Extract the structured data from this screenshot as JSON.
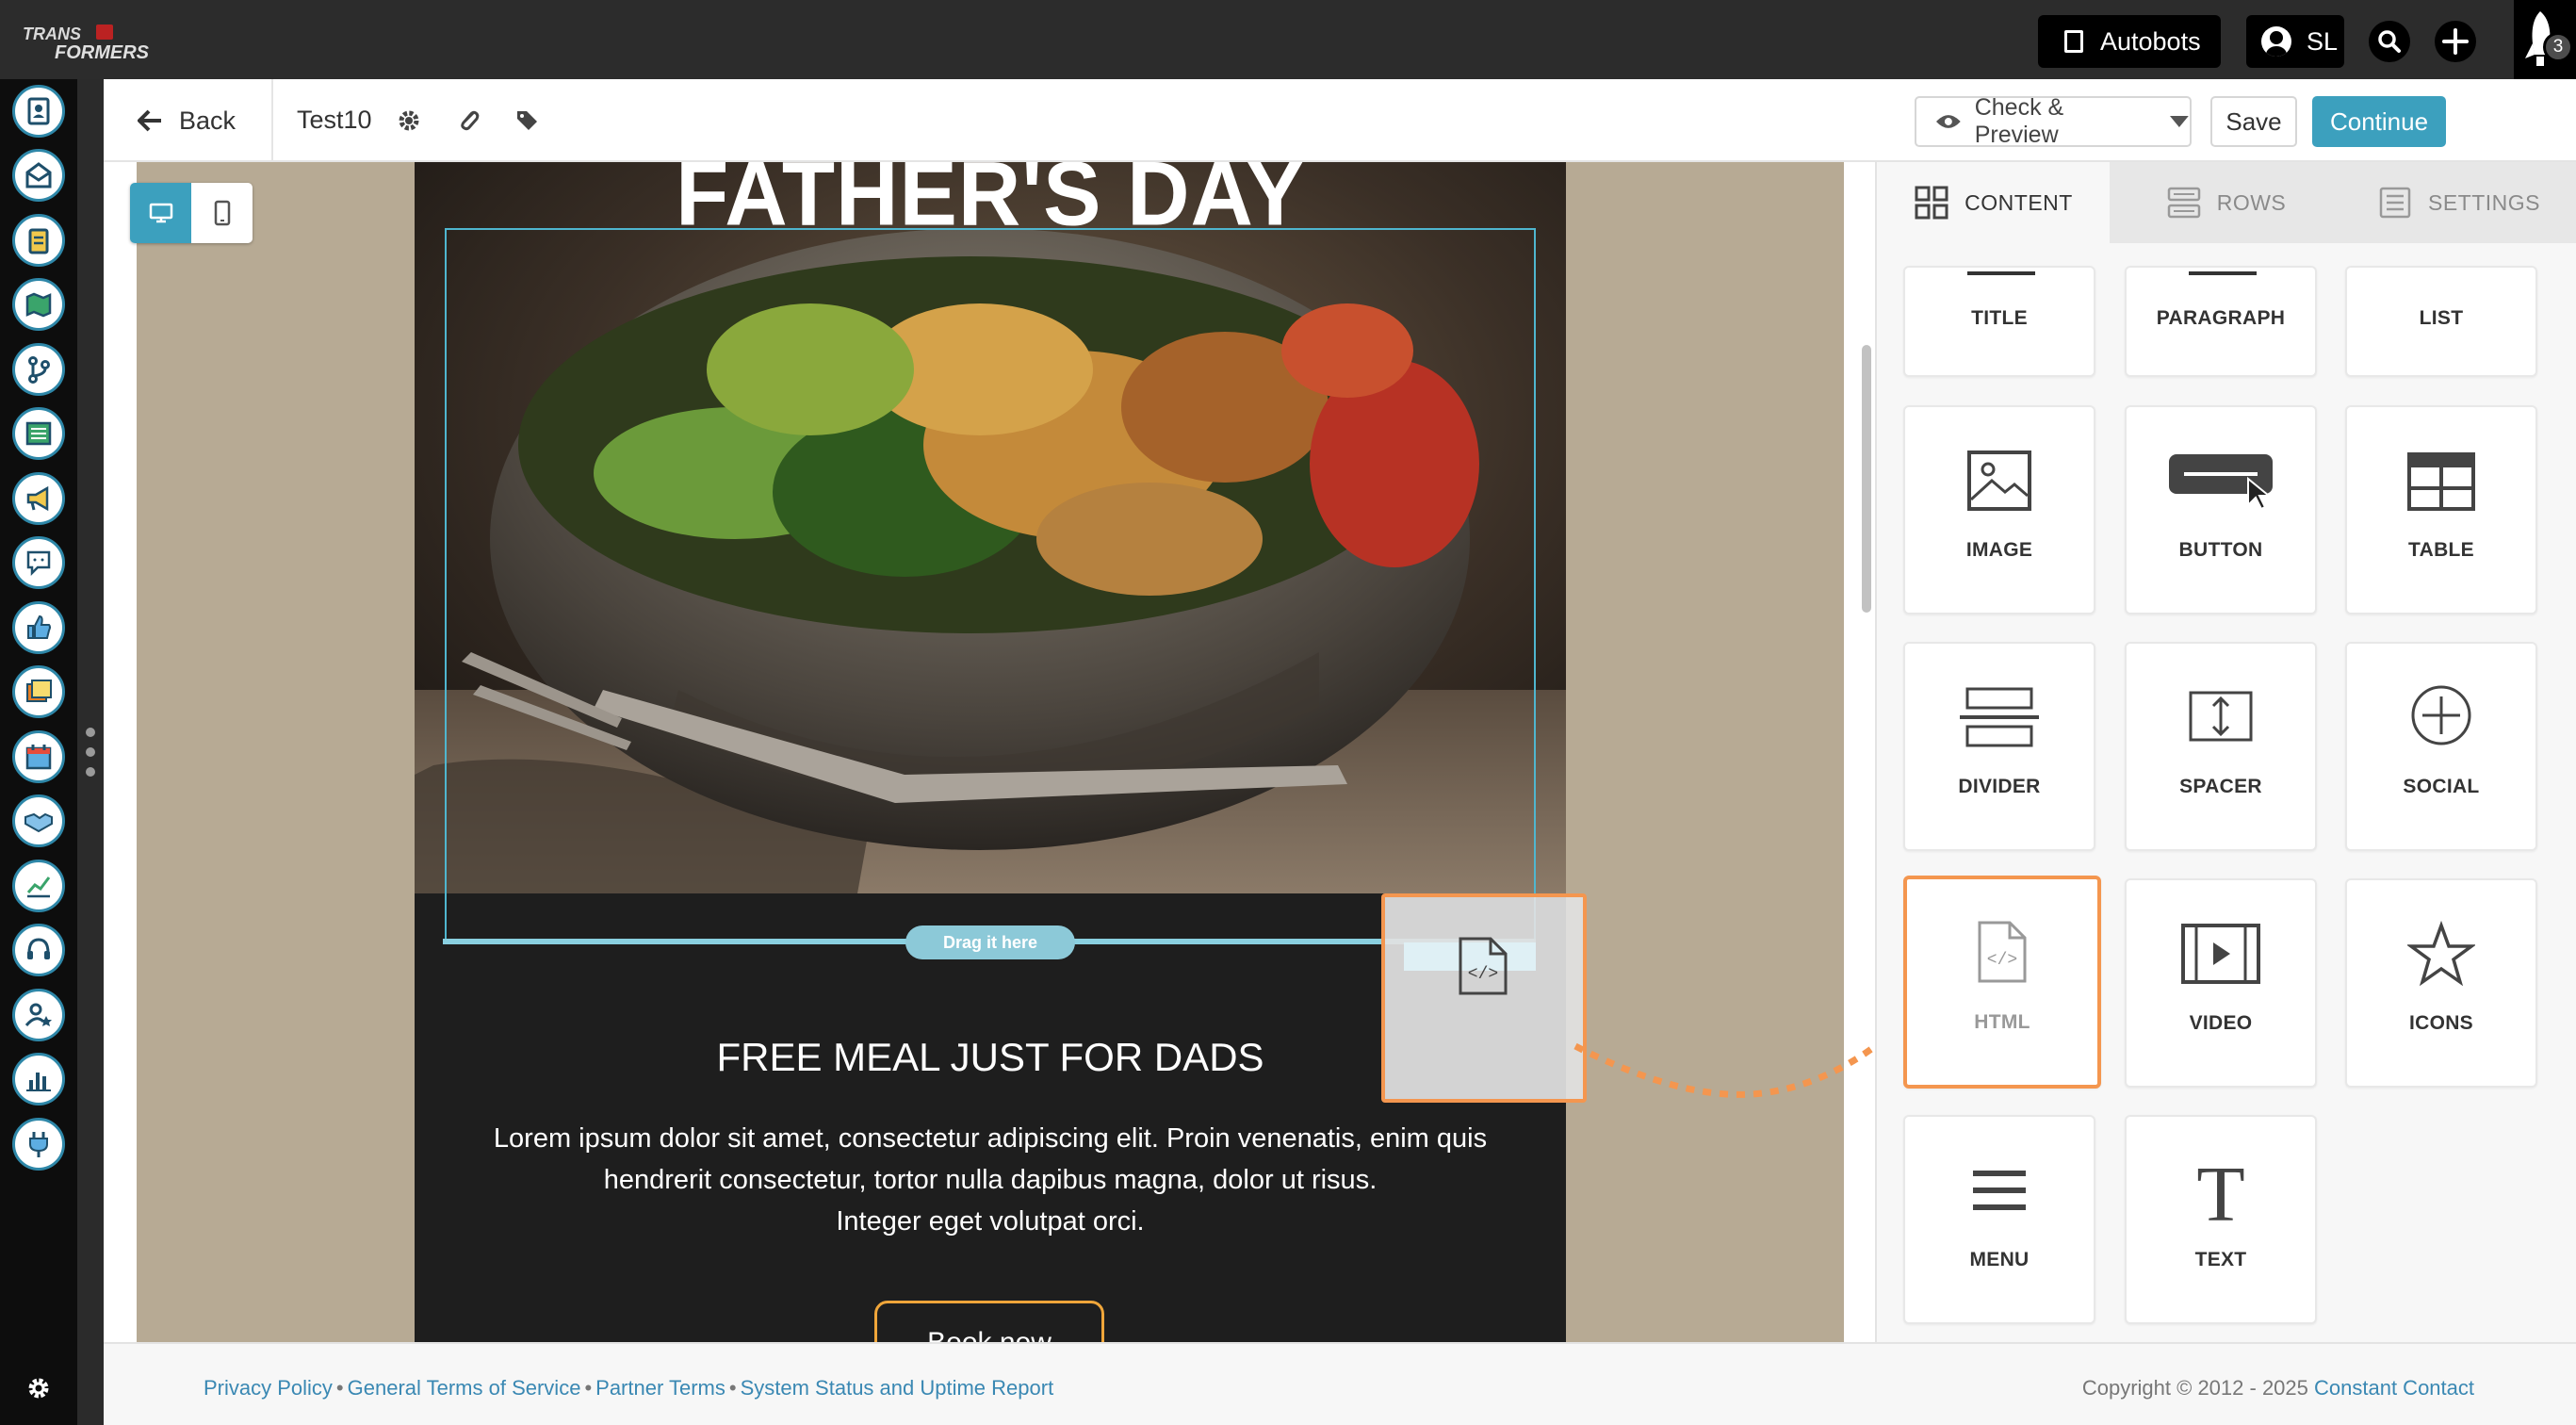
{
  "topbar": {
    "logo_text": "TRANSFORMERS",
    "org_name": "Autobots",
    "user_initials": "SL",
    "notification_count": "3"
  },
  "editor": {
    "back_label": "Back",
    "doc_title": "Test10",
    "preview_label": "Check & Preview",
    "save_label": "Save",
    "continue_label": "Continue"
  },
  "email": {
    "hero_title": "FATHER'S DAY",
    "drop_hint": "Drag it here",
    "heading": "FREE MEAL JUST FOR DADS",
    "body_line1": "Lorem ipsum dolor sit amet, consectetur adipiscing elit. Proin venenatis, enim quis",
    "body_line2": "hendrerit consectetur, tortor nulla dapibus magna, dolor ut risus.",
    "body_line3": "Integer eget volutpat orci.",
    "cta": "Book now"
  },
  "panel": {
    "tabs": [
      "CONTENT",
      "ROWS",
      "SETTINGS"
    ],
    "active_tab": "CONTENT",
    "blocks": [
      "TITLE",
      "PARAGRAPH",
      "LIST",
      "IMAGE",
      "BUTTON",
      "TABLE",
      "DIVIDER",
      "SPACER",
      "SOCIAL",
      "HTML",
      "VIDEO",
      "ICONS",
      "MENU",
      "TEXT"
    ]
  },
  "footer": {
    "links": [
      "Privacy Policy",
      "General Terms of Service",
      "Partner Terms",
      "System Status and Uptime Report"
    ],
    "copyright": "Copyright © 2012 - 2025",
    "company": "Constant Contact"
  },
  "colors": {
    "accent": "#3ca0be",
    "drag_highlight": "#f4964f",
    "cta_border": "#f0a63a",
    "topbar": "#2c2c2c"
  }
}
